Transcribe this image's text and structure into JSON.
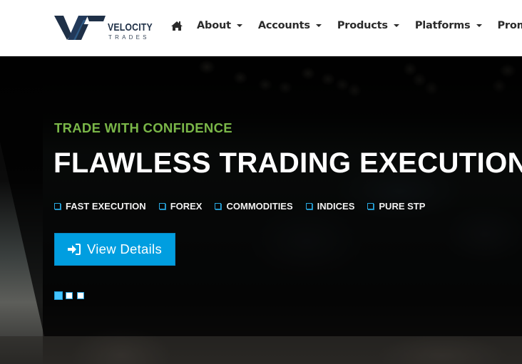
{
  "brand": {
    "name": "VELOCITY",
    "tagline": "TRADES",
    "colors": {
      "primary": "#1f3047",
      "accent": "#2a4c6b"
    }
  },
  "nav": {
    "home_icon": "home-icon",
    "items": [
      {
        "label": "About",
        "has_dropdown": true
      },
      {
        "label": "Accounts",
        "has_dropdown": true
      },
      {
        "label": "Products",
        "has_dropdown": true
      },
      {
        "label": "Platforms",
        "has_dropdown": true
      },
      {
        "label": "Promotions",
        "has_dropdown": false
      }
    ]
  },
  "hero": {
    "kicker": "TRADE WITH CONFIDENCE",
    "headline": "FLAWLESS TRADING EXECUTION",
    "features": [
      "FAST EXECUTION",
      "FOREX",
      "COMMODITIES",
      "INDICES",
      "PURE STP"
    ],
    "feature_icon": "checkbox-square-icon",
    "cta": {
      "label": "View Details",
      "icon": "sign-in-icon"
    },
    "slider": {
      "total": 3,
      "active": 1
    },
    "colors": {
      "kicker": "#7ab648",
      "cta": "#009ee0",
      "feature_box": "#29a8e0",
      "dot_active": "#44c3ff"
    }
  }
}
